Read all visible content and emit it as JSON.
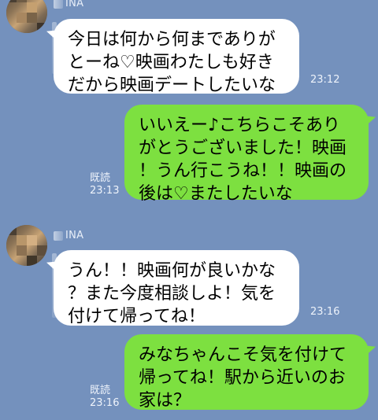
{
  "conversation": {
    "messages": [
      {
        "side": "in",
        "sender": "INA",
        "text": "今日は何から何までありが\nとーね♡映画わたしも好き\nだから映画デートしたいな",
        "time": "23:12"
      },
      {
        "side": "out",
        "read_label": "既読",
        "text": "いいえー♪こちらこそあり\nがとうございました！映画\n！うん行こうね！！映画の\n後は♡またしたいな",
        "time": "23:13"
      },
      {
        "side": "in",
        "sender": "INA",
        "text": "うん！！映画何が良いかな\n？また今度相談しよ！気を\n付けて帰ってね！",
        "time": "23:16"
      },
      {
        "side": "out",
        "read_label": "既読",
        "text": "みなちゃんこそ気を付けて\n帰ってね！駅から近いのお\n家は？",
        "time": "23:16"
      }
    ]
  },
  "colors": {
    "background": "#7491bd",
    "incoming_bubble": "#ffffff",
    "outgoing_bubble": "#7de040",
    "meta_text": "#eef3fb"
  },
  "icons": {
    "avatar": "pixelated-profile-avatar"
  }
}
